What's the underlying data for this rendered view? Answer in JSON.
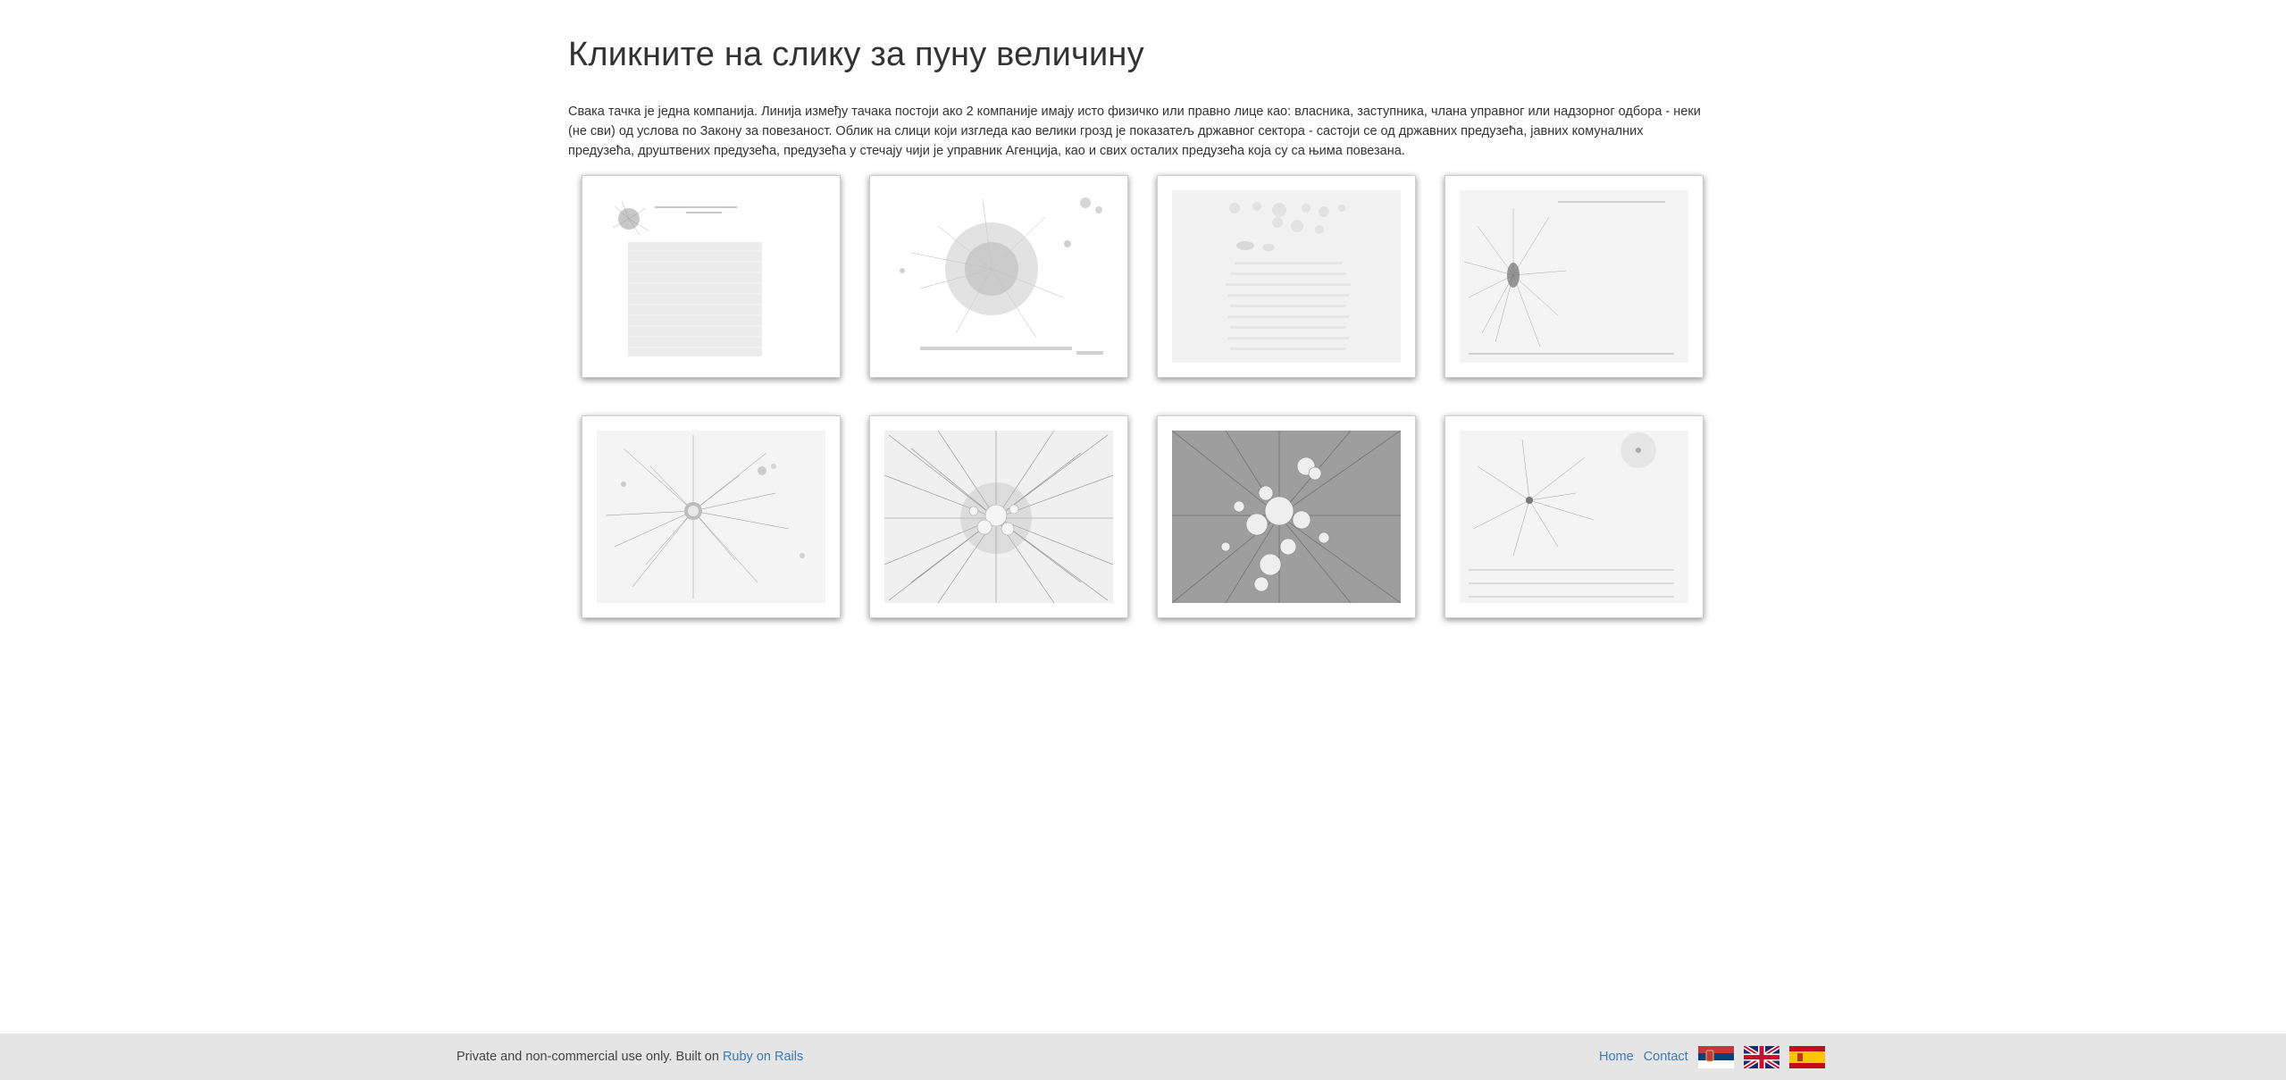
{
  "page": {
    "title": "Кликните на слику за пуну величину",
    "intro": "Свака тачка је једна компанија. Линија између тачака постоји ако 2 компаније имају исто физичко или правно лице као: власника, заступника, члана управног или надзорног одбора - неки (не сви) од услова по Закону за повезаност. Облик на слици који изгледа као велики грозд је показатељ државног сектора - састоји се од државних предузећа, јавних комуналних предузећа, друштвених предузећа, предузећа у стечају чији је управник Агенција, као и свих осталих предузећа која су са њима повезана."
  },
  "gallery": {
    "thumbnails": [
      {
        "name": "network-thumbnail-1"
      },
      {
        "name": "network-thumbnail-2"
      },
      {
        "name": "network-thumbnail-3"
      },
      {
        "name": "network-thumbnail-4"
      },
      {
        "name": "network-thumbnail-5"
      },
      {
        "name": "network-thumbnail-6"
      },
      {
        "name": "network-thumbnail-7"
      },
      {
        "name": "network-thumbnail-8"
      }
    ]
  },
  "footer": {
    "notice": "Private and non-commercial use only. Built on ",
    "rails_link": "Ruby on Rails",
    "home_link": "Home",
    "contact_link": "Contact",
    "flags": [
      "serbia-flag-icon",
      "uk-flag-icon",
      "spain-flag-icon"
    ],
    "link_color": "#3a7ab7",
    "background_color": "#e5e5e5"
  }
}
